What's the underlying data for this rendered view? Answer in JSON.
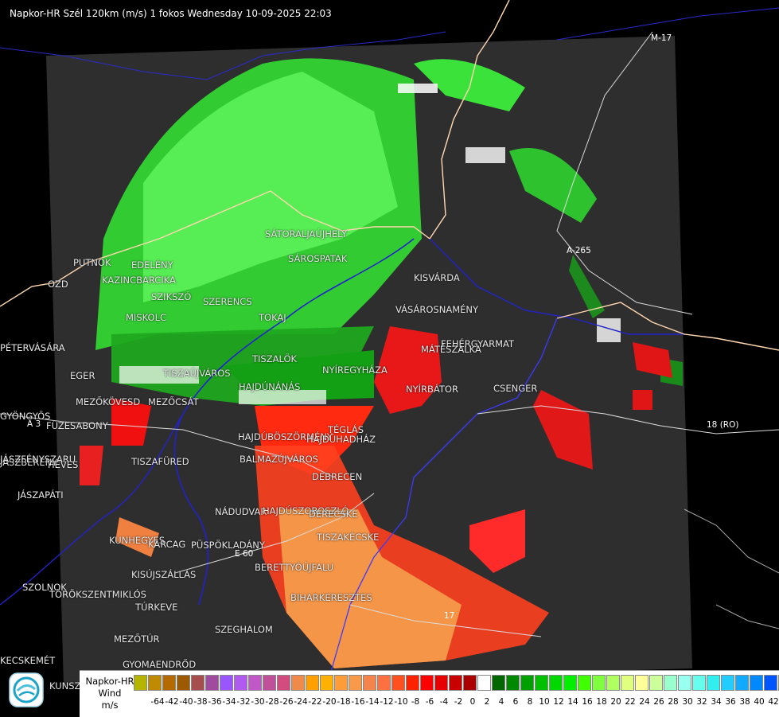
{
  "header": {
    "title": "Napkor-HR Szél 120km (m/s) 1 fokos Wednesday 10-09-2025 22:03"
  },
  "places": [
    "SÁTORALJAÚJHELY",
    "SÁROSPATAK",
    "KISVÁRDA",
    "VÁSÁROSNAMÉNY",
    "FEHÉRGYARMAT",
    "MÁTÉSZALKA",
    "NYÍRBÁTOR",
    "CSENGER",
    "NYÍREGYHÁZA",
    "TOKAJ",
    "SZERENCS",
    "SZIKSZÓ",
    "KAZINCBARCIKA",
    "EDELÉNY",
    "PUTNOK",
    "MISKOLC",
    "TISZAÚJVÁROS",
    "TISZALÖK",
    "EGER",
    "MEZŐKÖVESD",
    "MEZŐCSÁT",
    "HAJDÚNÁNÁS",
    "HAJDÚBÖSZÖRMÉNY",
    "HAJDÚHADHÁZ",
    "TÉGLÁS",
    "BALMAZÚJVÁROS",
    "DEBRECEN",
    "TISZAFÜRED",
    "FÜZESABONY",
    "HEVES",
    "JÁSZAPÁTI",
    "NÁDUDVAR",
    "HAJDÚSZOBOSZLÓ",
    "DERECSKE",
    "KUNHEGYES",
    "PÜSPÖKLADÁNY",
    "KARCAG",
    "BERETTYÓÚJFALU",
    "KISÚJSZÁLLÁS",
    "BIHARKERESZTES",
    "SZOLNOK",
    "TÖRÖKSZENTMIKLÓS",
    "TÚRKEVE",
    "SZEGHALOM",
    "MEZŐTÚR",
    "GYOMAENDRŐD",
    "PÉTERVÁSÁRA",
    "GYÖNGYÖS",
    "JÁSZBERÉNY",
    "OZD",
    "JÁSZFÉNYSZARU",
    "KECSKEMÉT",
    "TISZAKÉCSKE",
    "KUNSZENTMÁRTON"
  ],
  "roads": [
    "M-17",
    "A-265",
    "18 (RO)",
    "A 3",
    "E 60",
    "17"
  ],
  "legend": {
    "title_lines": [
      "Napkor-HR",
      "Wind",
      "m/s"
    ],
    "colors": [
      "#b5b500",
      "#c08a00",
      "#b46a00",
      "#9e5a00",
      "#a64d4d",
      "#a04aa0",
      "#9b55ff",
      "#b05af0",
      "#c058c8",
      "#c0509a",
      "#d24d7d",
      "#ef8a4a",
      "#ff9f00",
      "#ffb000",
      "#ff9d3b",
      "#f99a4a",
      "#f4844b",
      "#ff7040",
      "#ff5020",
      "#ff2200",
      "#ff0000",
      "#e60000",
      "#c80000",
      "#aa0000",
      "#ffffff",
      "#006600",
      "#008800",
      "#00a000",
      "#00c000",
      "#00d800",
      "#00f000",
      "#40ff00",
      "#80ff40",
      "#b0ff60",
      "#e0ff80",
      "#ffff99",
      "#ccff99",
      "#99ffcc",
      "#99ffee",
      "#66ffee",
      "#33eeee",
      "#22ccff",
      "#11aaff",
      "#0088ff",
      "#0055ff",
      "#0022ff",
      "#0000ee"
    ],
    "ticks": [
      "-64",
      "-42",
      "-40",
      "-38",
      "-36",
      "-34",
      "-32",
      "-30",
      "-28",
      "-26",
      "-24",
      "-22",
      "-20",
      "-18",
      "-16",
      "-14",
      "-12",
      "-10",
      "-8",
      "-6",
      "-4",
      "-2",
      "0",
      "2",
      "4",
      "6",
      "8",
      "10",
      "12",
      "14",
      "16",
      "18",
      "20",
      "22",
      "24",
      "26",
      "28",
      "30",
      "32",
      "34",
      "36",
      "38",
      "40",
      "42"
    ]
  }
}
